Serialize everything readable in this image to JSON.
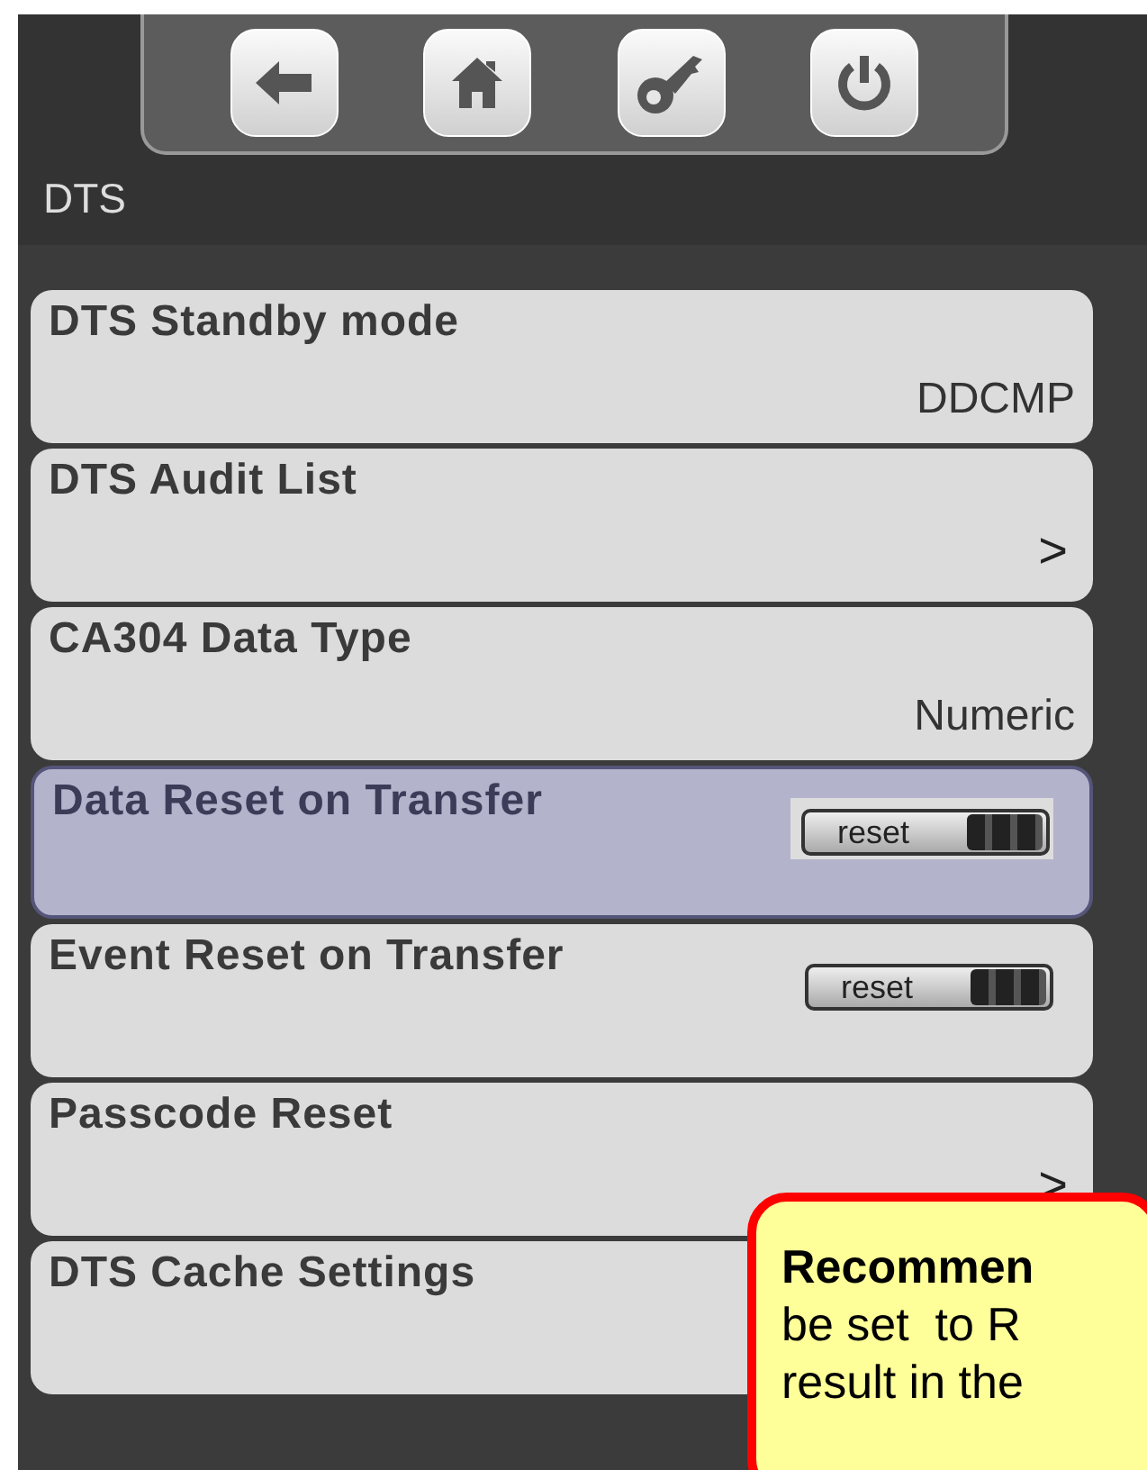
{
  "screen": {
    "title": "DTS"
  },
  "toolbar": [
    {
      "kind": "back"
    },
    {
      "kind": "home"
    },
    {
      "kind": "key"
    },
    {
      "kind": "power"
    }
  ],
  "items": [
    {
      "label": "DTS Standby mode",
      "kind": "value",
      "value": "DDCMP",
      "selected": false
    },
    {
      "label": "DTS Audit List",
      "kind": "link",
      "value": ">",
      "selected": false
    },
    {
      "label": "CA304 Data Type",
      "kind": "value",
      "value": "Numeric",
      "selected": false
    },
    {
      "label": "Data Reset on Transfer",
      "kind": "toggle",
      "value": "reset",
      "selected": true
    },
    {
      "label": "Event Reset on Transfer",
      "kind": "toggle",
      "value": "reset",
      "selected": false
    },
    {
      "label": "Passcode Reset",
      "kind": "link",
      "value": ">",
      "selected": false
    },
    {
      "label": "DTS Cache Settings",
      "kind": "none",
      "selected": false
    }
  ],
  "callout": {
    "lines": [
      "Recommen",
      "be set  to R",
      "result in the"
    ]
  }
}
